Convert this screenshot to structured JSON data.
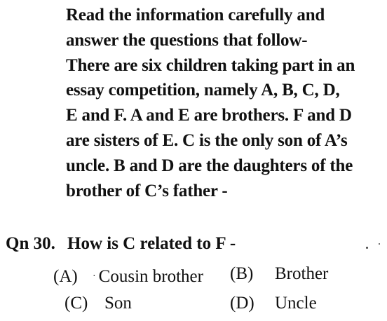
{
  "passage": {
    "lines": [
      "Read the information carefully and",
      "answer the questions that follow-",
      "There are six children taking part in an",
      "essay competition, namely A, B, C, D,",
      "E and F. A and E are brothers. F and D",
      "are sisters of E. C is the only son of A’s",
      "uncle. B and D are the daughters of the",
      "brother of C’s father -"
    ]
  },
  "question": {
    "number": "Qn 30.",
    "text": "How is C related to F -"
  },
  "options": [
    {
      "label": "(A)",
      "text": "Cousin brother"
    },
    {
      "label": "(B)",
      "text": "Brother"
    },
    {
      "label": "(C)",
      "text": "Son"
    },
    {
      "label": "(D)",
      "text": "Uncle"
    }
  ]
}
